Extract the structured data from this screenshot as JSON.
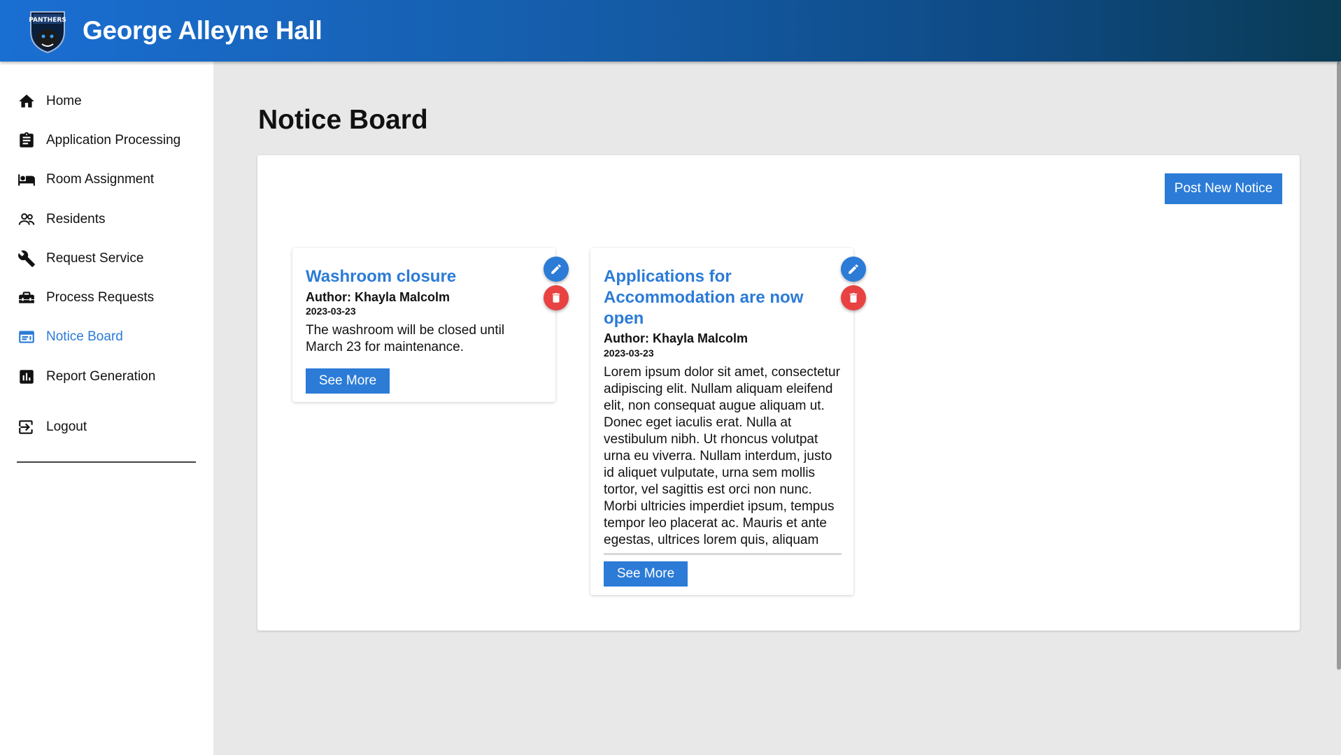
{
  "header": {
    "title": "George Alleyne Hall",
    "logo_text": "PANTHERS"
  },
  "sidebar": {
    "items": [
      {
        "label": "Home",
        "icon": "home-icon"
      },
      {
        "label": "Application Processing",
        "icon": "clipboard-icon"
      },
      {
        "label": "Room Assignment",
        "icon": "bed-icon"
      },
      {
        "label": "Residents",
        "icon": "people-icon"
      },
      {
        "label": "Request Service",
        "icon": "wrench-icon"
      },
      {
        "label": "Process Requests",
        "icon": "toolbox-icon"
      },
      {
        "label": "Notice Board",
        "icon": "board-icon",
        "active": true
      },
      {
        "label": "Report Generation",
        "icon": "bar-chart-icon"
      }
    ],
    "logout": {
      "label": "Logout",
      "icon": "logout-icon"
    }
  },
  "page": {
    "title": "Notice Board",
    "post_button": "Post New Notice"
  },
  "notices": [
    {
      "title": "Washroom closure",
      "author": "Author: Khayla Malcolm",
      "date": "2023-03-23",
      "body": "The washroom will be closed until March 23 for maintenance.",
      "see_more": "See More"
    },
    {
      "title": "Applications for Accommodation are now open",
      "author": "Author: Khayla Malcolm",
      "date": "2023-03-23",
      "body": "Lorem ipsum dolor sit amet, consectetur adipiscing elit. Nullam aliquam eleifend elit, non consequat augue aliquam ut. Donec eget iaculis erat. Nulla at vestibulum nibh. Ut rhoncus volutpat urna eu viverra. Nullam interdum, justo id aliquet vulputate, urna sem mollis tortor, vel sagittis est orci non nunc. Morbi ultricies imperdiet ipsum, tempus tempor leo placerat ac. Mauris et ante egestas, ultrices lorem quis, aliquam",
      "see_more": "See More"
    }
  ],
  "colors": {
    "accent": "#2b7bd7",
    "danger": "#e84242",
    "header_start": "#1a6fd3",
    "header_end": "#0a3b55"
  }
}
